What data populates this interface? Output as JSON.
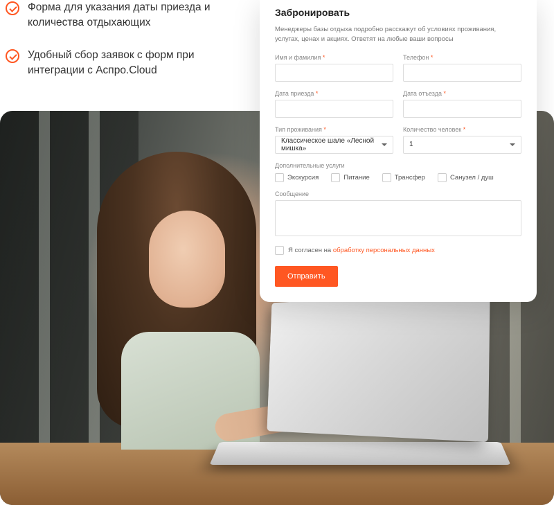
{
  "features": [
    "Форма для указания даты приезда и количества отдыхающих",
    "Удобный сбор заявок с форм при интеграции с Аспро.Cloud"
  ],
  "form": {
    "title": "Забронировать",
    "description": "Менеджеры базы отдыха подробно расскажут об условиях проживания, услугах, ценах и акциях. Ответят на любые ваши вопросы",
    "fields": {
      "name_label": "Имя и фамилия",
      "phone_label": "Телефон",
      "arrival_label": "Дата приезда",
      "departure_label": "Дата отъезда",
      "type_label": "Тип проживания",
      "type_value": "Классическое шале «Лесной мишка»",
      "people_label": "Количество человек",
      "people_value": "1",
      "services_label": "Дополнительные услуги",
      "message_label": "Сообщение"
    },
    "services": [
      "Экскурсия",
      "Питание",
      "Трансфер",
      "Санузел / душ"
    ],
    "consent_prefix": "Я согласен на ",
    "consent_link": "обработку персональных данных",
    "submit": "Отправить"
  }
}
